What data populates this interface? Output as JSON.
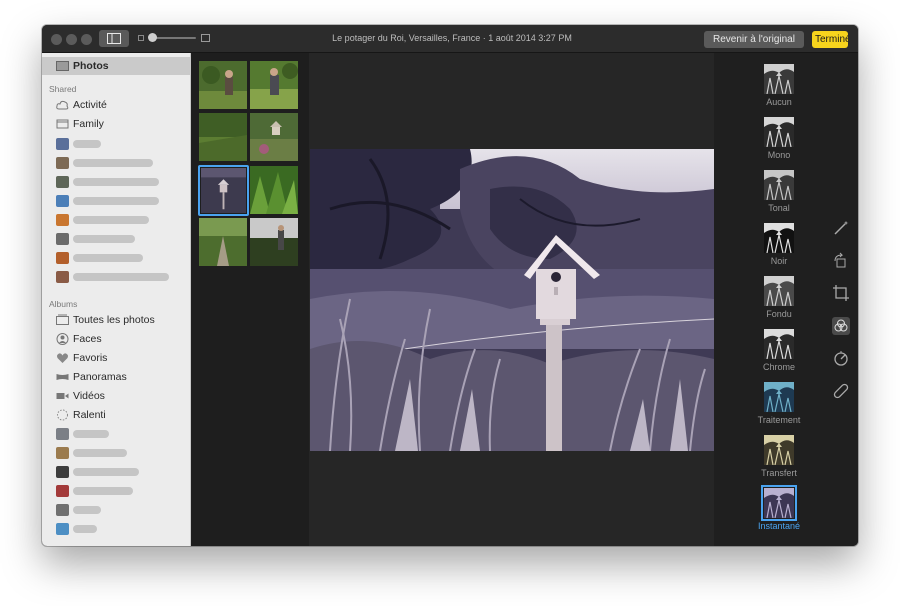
{
  "window": {
    "title": "Le potager du Roi, Versailles, France  ·  1 août 2014 3:27 PM",
    "revert_label": "Revenir à l'original",
    "done_label": "Terminé"
  },
  "sidebar": {
    "main_item": "Photos",
    "shared_header": "Shared",
    "shared_items": [
      "Activité",
      "Family"
    ],
    "albums_header": "Albums",
    "album_items": [
      "Toutes les photos",
      "Faces",
      "Favoris",
      "Panoramas",
      "Vidéos",
      "Ralenti"
    ]
  },
  "filters": [
    {
      "label": "Aucun",
      "icon": "filter-none"
    },
    {
      "label": "Mono",
      "icon": "filter-mono"
    },
    {
      "label": "Tonal",
      "icon": "filter-tonal"
    },
    {
      "label": "Noir",
      "icon": "filter-noir"
    },
    {
      "label": "Fondu",
      "icon": "filter-fondu"
    },
    {
      "label": "Chrome",
      "icon": "filter-chrome"
    },
    {
      "label": "Traitement",
      "icon": "filter-traitement"
    },
    {
      "label": "Transfert",
      "icon": "filter-transfert"
    },
    {
      "label": "Instantané",
      "icon": "filter-instantane",
      "selected": true
    }
  ],
  "tools": [
    "magic-wand-icon",
    "rotate-icon",
    "crop-icon",
    "filters-icon",
    "adjust-icon",
    "retouch-icon"
  ],
  "colors": {
    "accent": "#4aa3f0",
    "done": "#f7d41d",
    "sidebar": "#ececec",
    "dark": "#1f1f1f"
  }
}
